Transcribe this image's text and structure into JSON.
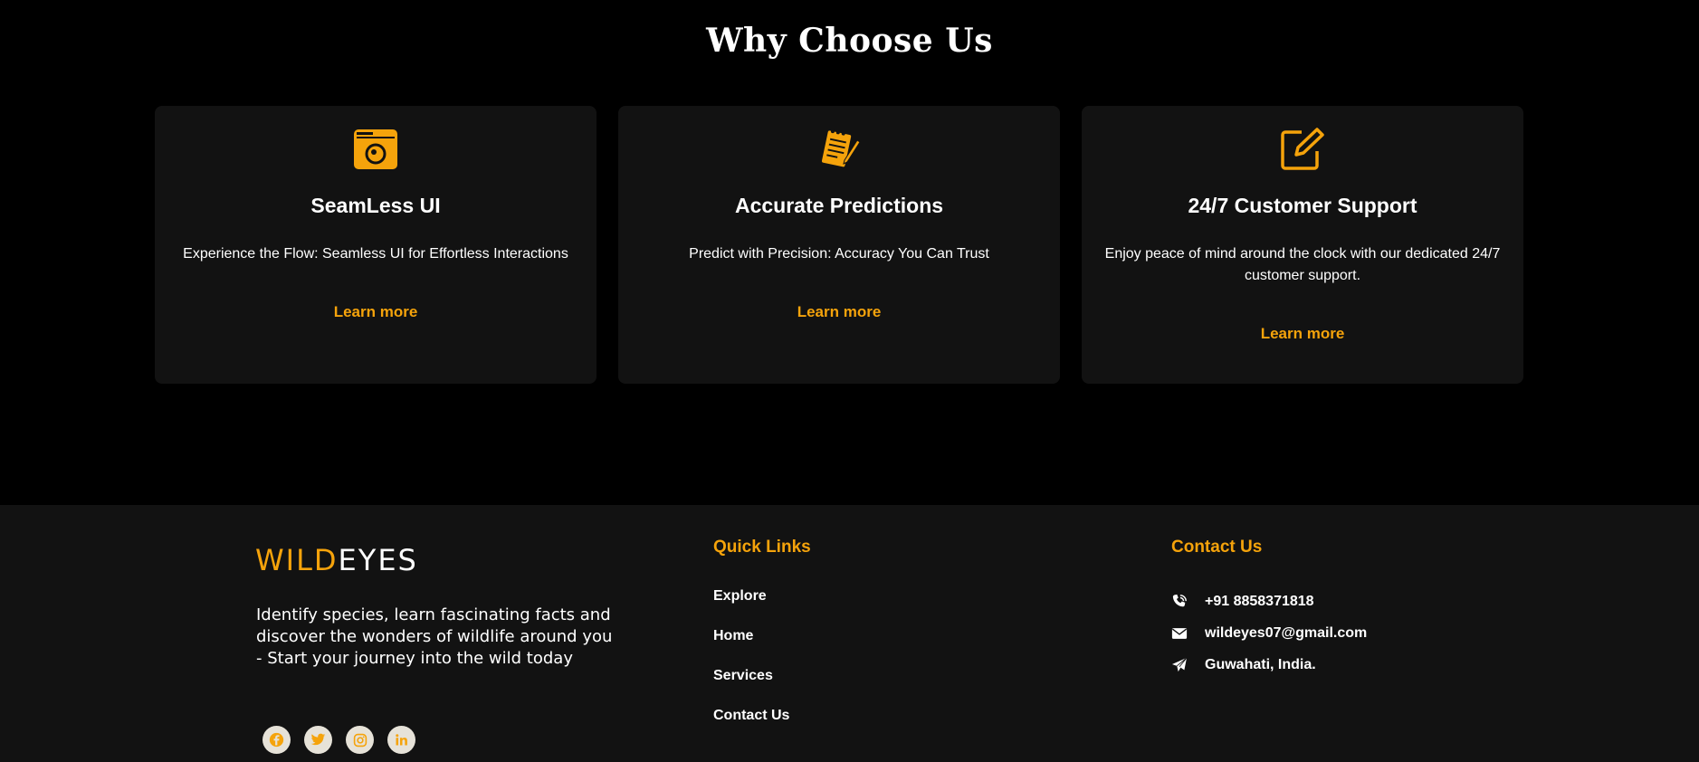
{
  "why_section": {
    "title": "Why Choose Us",
    "cards": [
      {
        "icon": "camera-icon",
        "title": "SeamLess UI",
        "description": "Experience the Flow: Seamless UI for Effortless Interactions",
        "link": "Learn more"
      },
      {
        "icon": "notepad-pencil-icon",
        "title": "Accurate Predictions",
        "description": "Predict with Precision: Accuracy You Can Trust",
        "link": "Learn more"
      },
      {
        "icon": "edit-icon",
        "title": "24/7 Customer Support",
        "description": "Enjoy peace of mind around the clock with our dedicated 24/7 customer support.",
        "link": "Learn more"
      }
    ]
  },
  "footer": {
    "logo": {
      "part1": "WILD",
      "part2": "EYES"
    },
    "tagline": "Identify species, learn fascinating facts and discover the wonders of wildlife around you\n- Start your journey into the wild today",
    "socials": [
      "facebook-icon",
      "twitter-icon",
      "instagram-icon",
      "linkedin-icon"
    ],
    "quick_links": {
      "heading": "Quick Links",
      "items": [
        "Explore",
        "Home",
        "Services",
        "Contact Us"
      ]
    },
    "contact": {
      "heading": "Contact Us",
      "items": [
        {
          "icon": "phone-icon",
          "text": "+91 8858371818"
        },
        {
          "icon": "envelope-icon",
          "text": "wildeyes07@gmail.com"
        },
        {
          "icon": "paper-plane-icon",
          "text": "Guwahati, India."
        }
      ]
    }
  },
  "colors": {
    "accent": "#f5a30b",
    "card_bg": "#121212",
    "page_bg": "#000000",
    "social_bg": "#e6e2d8"
  }
}
